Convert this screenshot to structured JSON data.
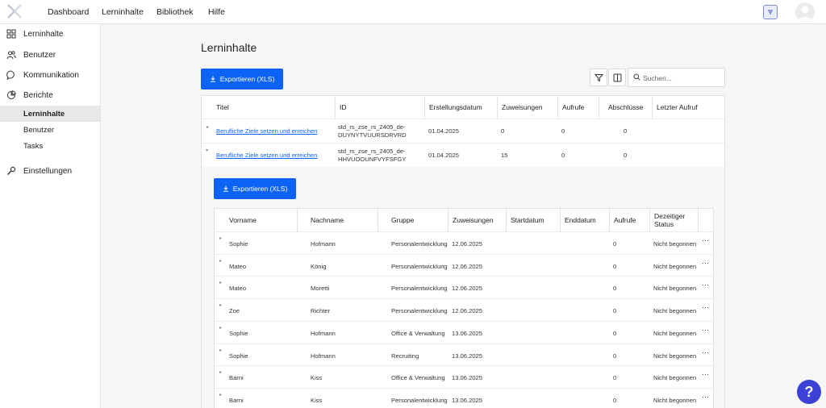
{
  "topnav": {
    "items": [
      "Dashboard",
      "Lerninhalte",
      "Bibliothek",
      "Hilfe"
    ]
  },
  "sidebar": {
    "items": [
      {
        "label": "Lerninhalte",
        "icon": "grid-icon"
      },
      {
        "label": "Benutzer",
        "icon": "users-icon"
      },
      {
        "label": "Kommunikation",
        "icon": "chat-icon"
      },
      {
        "label": "Berichte",
        "icon": "pie-chart-icon"
      },
      {
        "label": "Einstellungen",
        "icon": "wrench-icon"
      }
    ],
    "berichte_sub": [
      "Lerninhalte",
      "Benutzer",
      "Tasks"
    ]
  },
  "page": {
    "title": "Lerninhalte",
    "export_label": "Exportieren (XLS)",
    "search_placeholder": "Suchen..."
  },
  "content_table": {
    "headers": [
      "Titel",
      "ID",
      "Erstellungsdatum",
      "Zuweisungen",
      "Aufrufe",
      "Abschlüsse",
      "Letzter Aufruf"
    ],
    "rows": [
      {
        "title": "Berufliche Ziele setzen und erreichen",
        "id_line1": "std_rs_zse_rs_2405_de-",
        "id_line2": "DUYNYTVUURSDRVRD",
        "created": "01.04.2025",
        "assignments": "0",
        "views": "0",
        "completions": "0",
        "last_view": ""
      },
      {
        "title": "Berufliche Ziele setzen und erreichen",
        "id_line1": "std_rs_zse_rs_2405_de-",
        "id_line2": "HHVUOOUNFVYFSFGY",
        "created": "01.04.2025",
        "assignments": "15",
        "views": "0",
        "completions": "0",
        "last_view": ""
      }
    ]
  },
  "detail": {
    "export_label": "Exportieren (XLS)",
    "headers": [
      "Vorname",
      "Nachname",
      "Gruppe",
      "Zuweisungen",
      "Startdatum",
      "Enddatum",
      "Aufrufe",
      "Dezeitiger Status"
    ],
    "rows": [
      {
        "first": "Sophie",
        "last": "Hofmann",
        "group": "Personalentwicklung",
        "assigned": "12.06.2025",
        "start": "",
        "end": "",
        "views": "0",
        "status": "Nicht begonnen"
      },
      {
        "first": "Mateo",
        "last": "König",
        "group": "Personalentwicklung",
        "assigned": "12.06.2025",
        "start": "",
        "end": "",
        "views": "0",
        "status": "Nicht begonnen"
      },
      {
        "first": "Mateo",
        "last": "Moretti",
        "group": "Personalentwicklung",
        "assigned": "12.06.2025",
        "start": "",
        "end": "",
        "views": "0",
        "status": "Nicht begonnen"
      },
      {
        "first": "Zoe",
        "last": "Richter",
        "group": "Personalentwicklung",
        "assigned": "12.06.2025",
        "start": "",
        "end": "",
        "views": "0",
        "status": "Nicht begonnen"
      },
      {
        "first": "Sophie",
        "last": "Hofmann",
        "group": "Office & Verwaltung",
        "assigned": "13.06.2025",
        "start": "",
        "end": "",
        "views": "0",
        "status": "Nicht begonnen"
      },
      {
        "first": "Sophie",
        "last": "Hofmann",
        "group": "Recruiting",
        "assigned": "13.06.2025",
        "start": "",
        "end": "",
        "views": "0",
        "status": "Nicht begonnen"
      },
      {
        "first": "Barni",
        "last": "Kiss",
        "group": "Office & Verwaltung",
        "assigned": "13.06.2025",
        "start": "",
        "end": "",
        "views": "0",
        "status": "Nicht begonnen"
      },
      {
        "first": "Barni",
        "last": "Kiss",
        "group": "Personalentwicklung",
        "assigned": "13.06.2025",
        "start": "",
        "end": "",
        "views": "0",
        "status": "Nicht begonnen"
      }
    ]
  },
  "help": {
    "label": "?"
  },
  "colors": {
    "primary": "#0d63f5",
    "help": "#3b41d6"
  }
}
